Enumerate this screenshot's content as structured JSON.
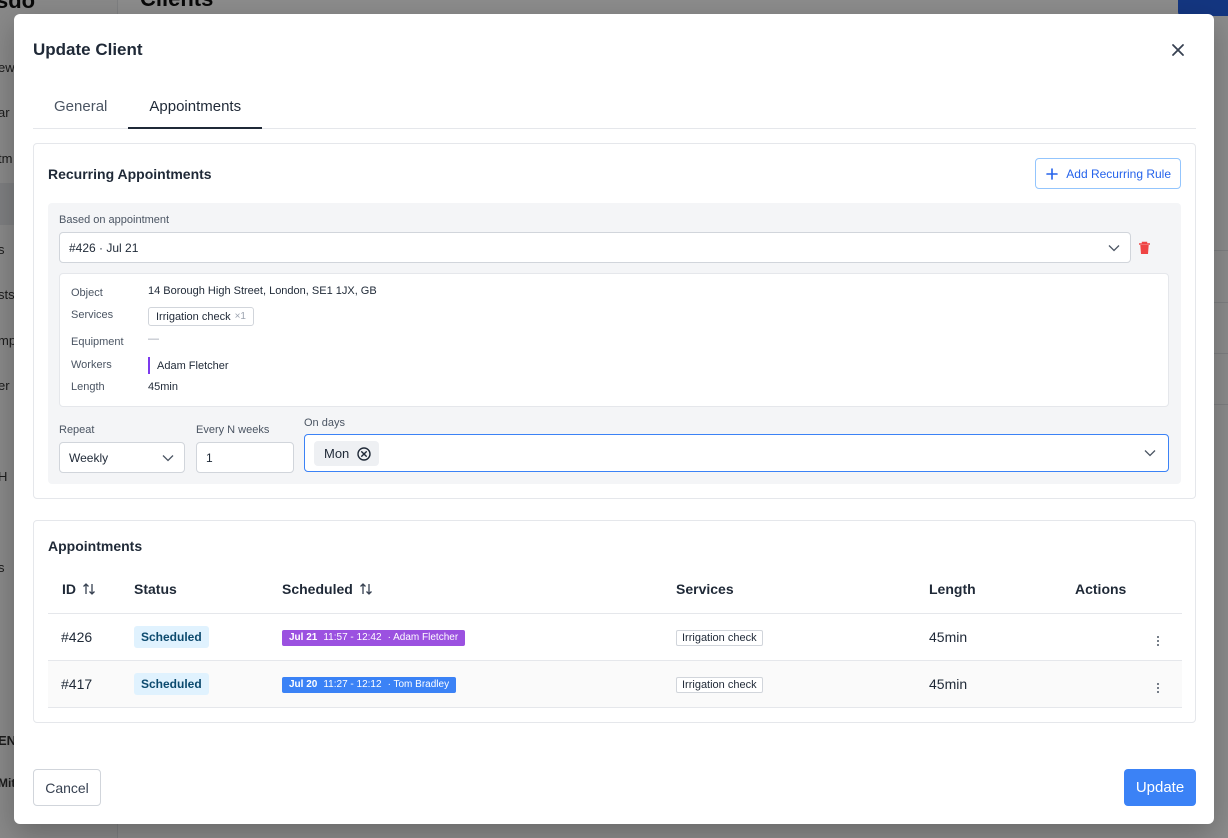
{
  "background": {
    "logo": "sdo",
    "page_title": "Clients",
    "sidebar_fragments": [
      "ew",
      "ar",
      "tm",
      "s",
      "sts",
      "mp",
      "er",
      "H",
      "s",
      "EN",
      "Mit"
    ]
  },
  "modal": {
    "title": "Update Client",
    "tabs": [
      {
        "label": "General",
        "active": false
      },
      {
        "label": "Appointments",
        "active": true
      }
    ],
    "recurring": {
      "title": "Recurring Appointments",
      "add_rule_label": "Add Recurring Rule",
      "based_on_label": "Based on appointment",
      "based_on_value": "#426 · Jul 21",
      "details": {
        "object_label": "Object",
        "object_value": "14 Borough High Street, London, SE1 1JX, GB",
        "services_label": "Services",
        "service_name": "Irrigation check",
        "service_qty": "×1",
        "equipment_label": "Equipment",
        "equipment_value": "—",
        "workers_label": "Workers",
        "worker_name": "Adam Fletcher",
        "length_label": "Length",
        "length_value": "45min"
      },
      "repeat_label": "Repeat",
      "repeat_value": "Weekly",
      "every_label": "Every N weeks",
      "every_value": "1",
      "days_label": "On days",
      "days": [
        "Mon"
      ]
    },
    "appointments": {
      "title": "Appointments",
      "columns": {
        "id": "ID",
        "status": "Status",
        "scheduled": "Scheduled",
        "services": "Services",
        "length": "Length",
        "actions": "Actions"
      },
      "rows": [
        {
          "id": "#426",
          "status": "Scheduled",
          "date": "Jul 21",
          "time": "11:57 - 12:42",
          "worker": "· Adam Fletcher",
          "pill_color": "#9b51e0",
          "service": "Irrigation check",
          "length": "45min"
        },
        {
          "id": "#417",
          "status": "Scheduled",
          "date": "Jul 20",
          "time": "11:27 - 12:12",
          "worker": "· Tom Bradley",
          "pill_color": "#3b82f6",
          "service": "Irrigation check",
          "length": "45min"
        }
      ]
    },
    "cancel_label": "Cancel",
    "update_label": "Update"
  },
  "colors": {
    "accent": "#3b82f6",
    "danger": "#ef4444",
    "worker_accent": "#7c3aed"
  }
}
